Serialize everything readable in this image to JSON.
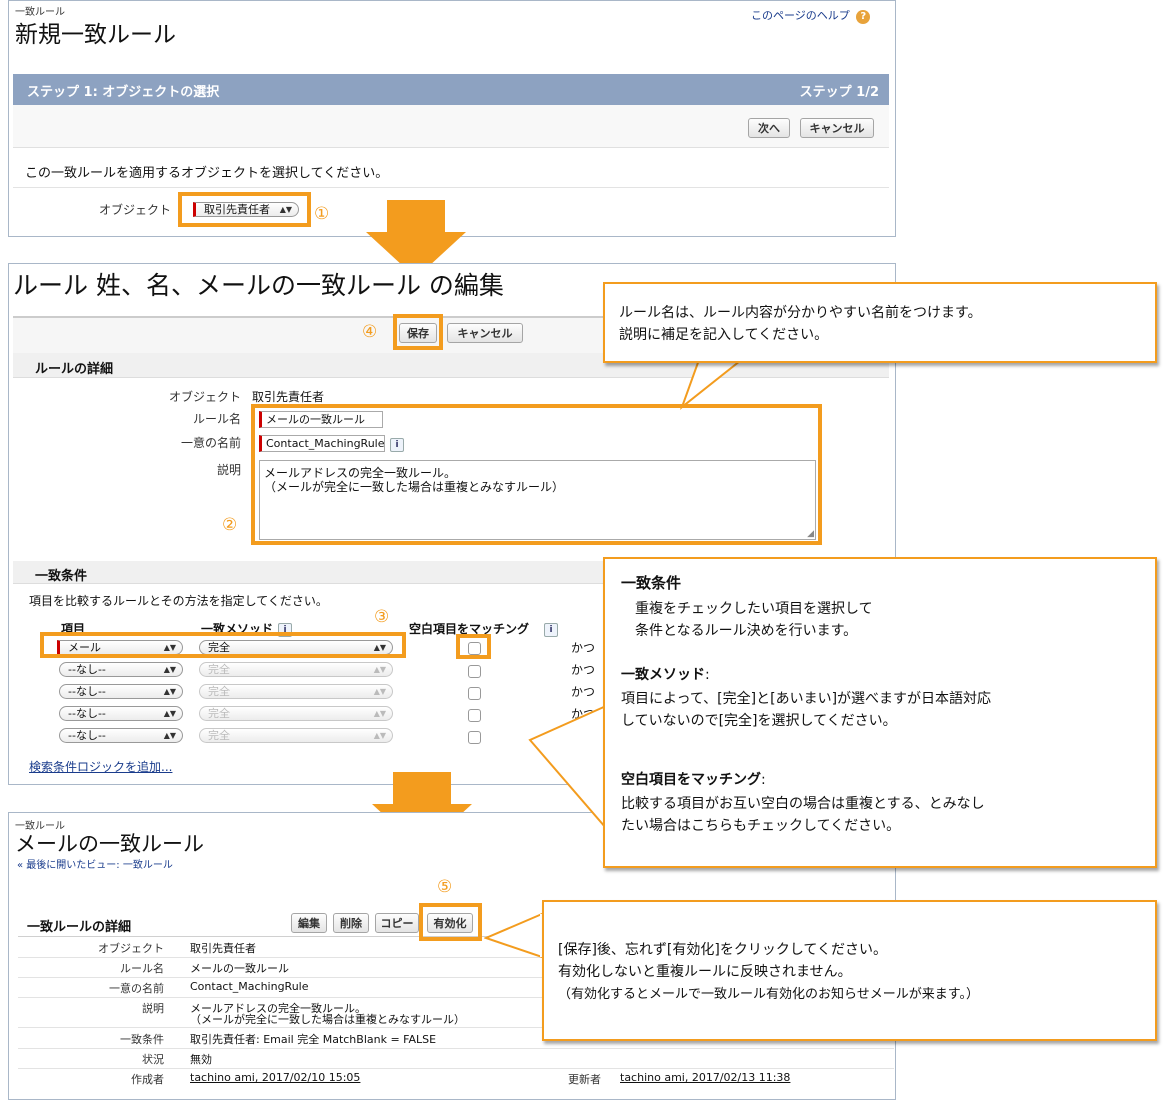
{
  "panel1": {
    "eyebrow": "一致ルール",
    "title": "新規一致ルール",
    "help": "このページのヘルプ",
    "step_title": "ステップ 1: オブジェクトの選択",
    "step_count": "ステップ 1/2",
    "next_button": "次へ",
    "cancel_button": "キャンセル",
    "instruction": "この一致ルールを適用するオブジェクトを選択してください。",
    "object_label": "オブジェクト",
    "object_value": "取引先責任者",
    "marker": "①"
  },
  "panel2": {
    "title": "ルール 姓、名、メールの一致ルール の編集",
    "save_button": "保存",
    "cancel_button": "キャンセル",
    "save_marker": "④",
    "details_header": "ルールの詳細",
    "object_label": "オブジェクト",
    "object_value": "取引先責任者",
    "rule_name_label": "ルール名",
    "rule_name_value": "メールの一致ルール",
    "unique_name_label": "一意の名前",
    "unique_name_value": "Contact_MachingRule",
    "description_label": "説明",
    "description_line1": "メールアドレスの完全一致ルール。",
    "description_line2": "（メールが完全に一致した場合は重複とみなすルール）",
    "details_marker": "②",
    "criteria_header": "一致条件",
    "criteria_instruction": "項目を比較するルールとその方法を指定してください。",
    "col_field": "項目",
    "col_method": "一致メソッド",
    "col_blank": "空白項目をマッチング",
    "criteria_marker": "③",
    "rows": [
      {
        "field": "メール",
        "method": "完全",
        "and": "かつ"
      },
      {
        "field": "--なし--",
        "method": "完全",
        "and": "かつ"
      },
      {
        "field": "--なし--",
        "method": "完全",
        "and": "かつ"
      },
      {
        "field": "--なし--",
        "method": "完全",
        "and": "かつ"
      },
      {
        "field": "--なし--",
        "method": "完全",
        "and": ""
      }
    ],
    "add_logic_link": "検索条件ロジックを追加..."
  },
  "panel3": {
    "eyebrow": "一致ルール",
    "title": "メールの一致ルール",
    "back_link": "« 最後に開いたビュー: 一致ルール",
    "activate_marker": "⑤",
    "section_title": "一致ルールの詳細",
    "edit_button": "編集",
    "delete_button": "削除",
    "copy_button": "コピー",
    "activate_button": "有効化",
    "fields": [
      {
        "label": "オブジェクト",
        "value": "取引先責任者"
      },
      {
        "label": "ルール名",
        "value": "メールの一致ルール"
      },
      {
        "label": "一意の名前",
        "value": "Contact_MachingRule"
      },
      {
        "label": "説明",
        "value": "メールアドレスの完全一致ルール。",
        "value2": "（メールが完全に一致した場合は重複とみなすルール）"
      },
      {
        "label": "一致条件",
        "value": "取引先責任者: Email 完全 MatchBlank = FALSE"
      },
      {
        "label": "状況",
        "value": "無効"
      },
      {
        "label": "作成者",
        "value": "tachino ami, 2017/02/10 15:05"
      }
    ],
    "updated_label": "更新者",
    "updated_value": "tachino ami, 2017/02/13 11:38"
  },
  "callout1": {
    "line1": "ルール名は、ルール内容が分かりやすい名前をつけます。",
    "line2": "説明に補足を記入してください。"
  },
  "callout2": {
    "heading1": "一致条件",
    "body1_line1": "重複をチェックしたい項目を選択して",
    "body1_line2": "条件となるルール決めを行います。",
    "heading2": "一致メソッド",
    "heading2_suffix": ":",
    "body2_line1": "項目によって、[完全]と[あいまい]が選べますが日本語対応",
    "body2_line2": "していないので[完全]を選択してください。",
    "heading3": "空白項目をマッチング",
    "heading3_suffix": ":",
    "body3_line1": "比較する項目がお互い空白の場合は重複とする、とみなし",
    "body3_line2": "たい場合はこちらもチェックしてください。"
  },
  "callout3": {
    "line1": "[保存]後、忘れず[有効化]をクリックしてください。",
    "line2": "有効化しないと重複ルールに反映されません。",
    "line3": "（有効化するとメールで一致ルール有効化のお知らせメールが来ます。）"
  },
  "colors": {
    "accent": "#f39c1e",
    "step_bar": "#8da2c1",
    "border": "#a9b7c8"
  }
}
